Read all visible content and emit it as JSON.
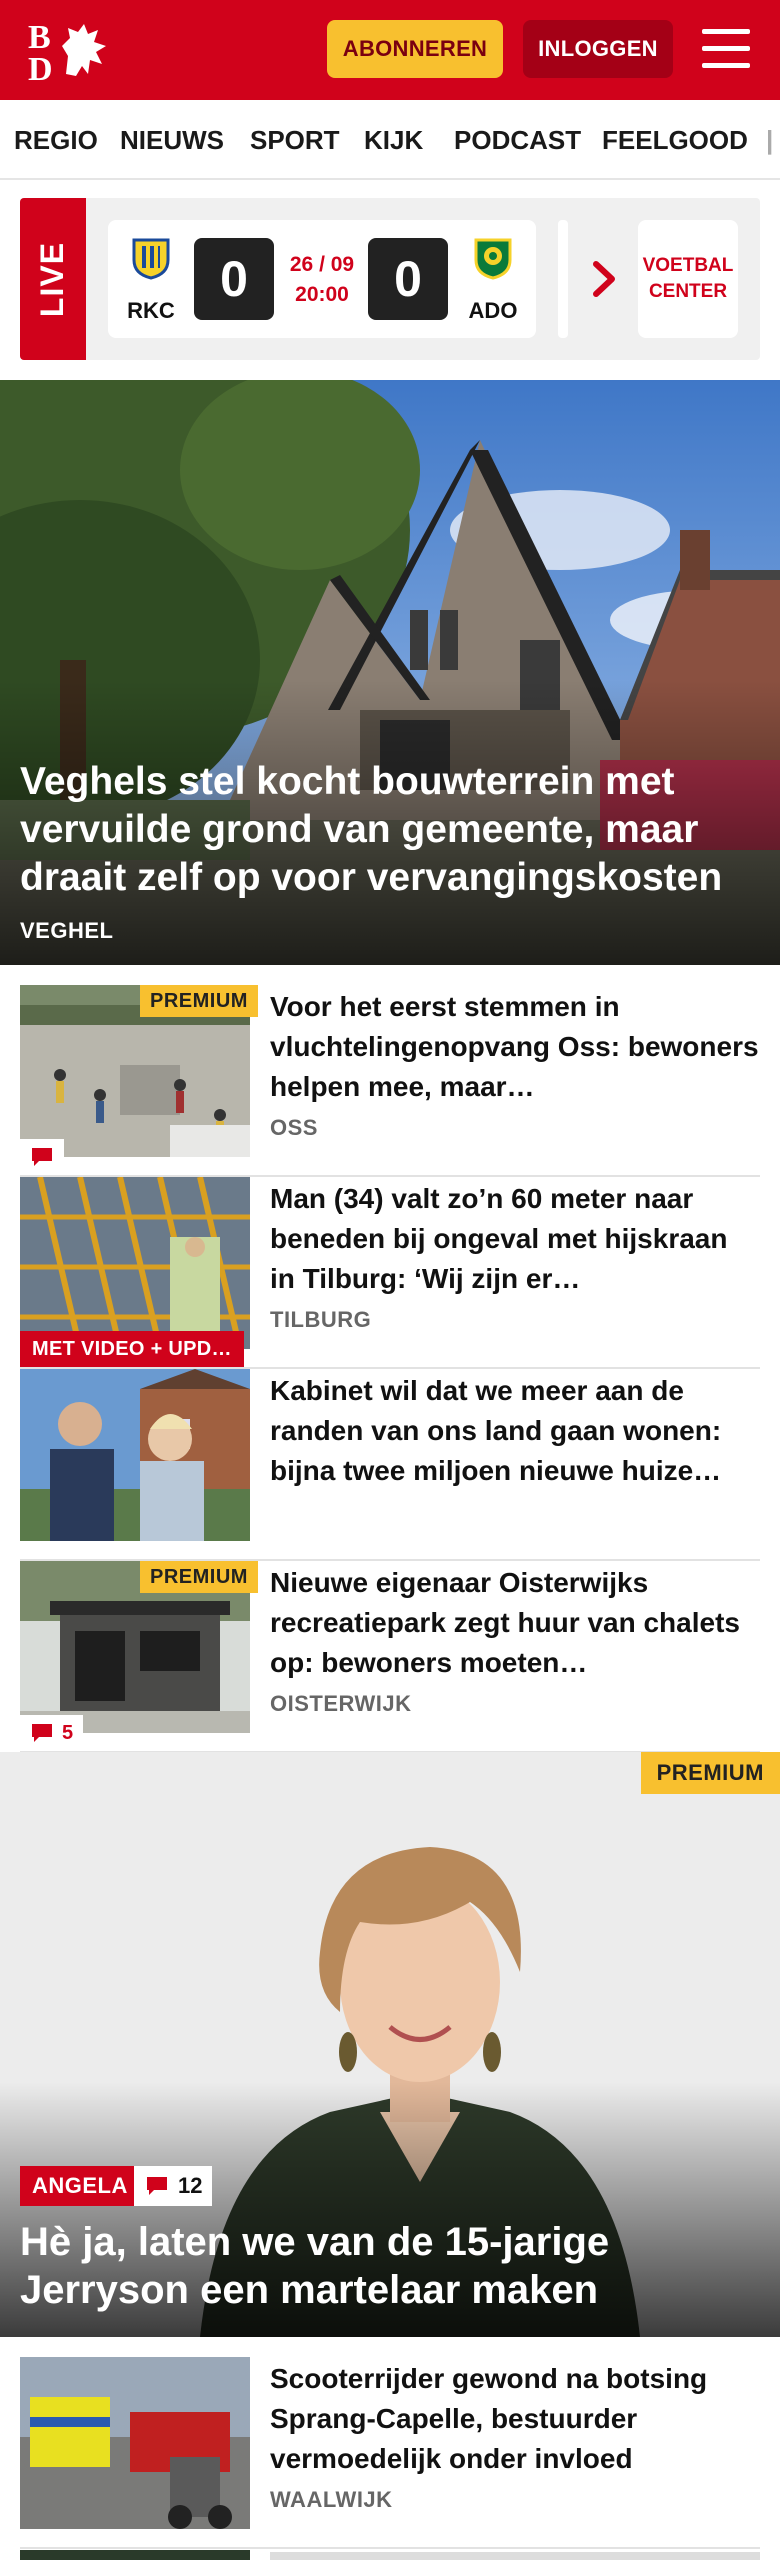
{
  "header": {
    "logo_text": "BD",
    "subscribe_label": "ABONNEREN",
    "login_label": "INLOGGEN",
    "menu_icon": "hamburger-menu-icon",
    "brand_color": "#d0021b",
    "accent_color": "#f8c02f"
  },
  "nav": {
    "items": [
      "REGIO",
      "NIEUWS",
      "SPORT",
      "KIJK",
      "PODCAST",
      "FEELGOOD"
    ]
  },
  "live": {
    "label": "LIVE",
    "match": {
      "home_team": "RKC",
      "home_score": "0",
      "date": "26 / 09",
      "time": "20:00",
      "away_score": "0",
      "away_team": "ADO"
    },
    "voetbal_center": "VOETBAL CENTER"
  },
  "hero": {
    "title": "Veghels stel kocht bouwterrein met vervuilde grond van gemeente, maar draait zelf op voor vervangingskosten",
    "tag": "VEGHEL"
  },
  "articles": [
    {
      "premium": "PREMIUM",
      "title": "Voor het eerst stemmen in vluchtelingenopvang Oss: bewoners helpen mee, maar…",
      "tag": "OSS",
      "comments": ""
    },
    {
      "badge": "MET VIDEO + UPD…",
      "title": "Man (34) valt zo’n 60 meter naar beneden bij ongeval met hijskraan in Tilburg: ‘Wij zijn er…",
      "tag": "TILBURG"
    },
    {
      "title": "Kabinet wil dat we meer aan de randen van ons land gaan wonen: bijna twee miljoen nieuwe huize…",
      "tag": ""
    },
    {
      "premium": "PREMIUM",
      "title": "Nieuwe eigenaar Oisterwijks recreatiepark zegt huur van chalets op: bewoners moeten…",
      "tag": "OISTERWIJK",
      "comments": "5"
    }
  ],
  "feature": {
    "premium": "PREMIUM",
    "label": "ANGELA",
    "comments": "12",
    "title": "Hè ja, laten we van de 15-jarige Jerryson een martelaar maken"
  },
  "article5": {
    "title": "Scooterrijder gewond na botsing Sprang-Capelle, bestuurder vermoedelijk onder invloed",
    "tag": "WAALWIJK"
  }
}
